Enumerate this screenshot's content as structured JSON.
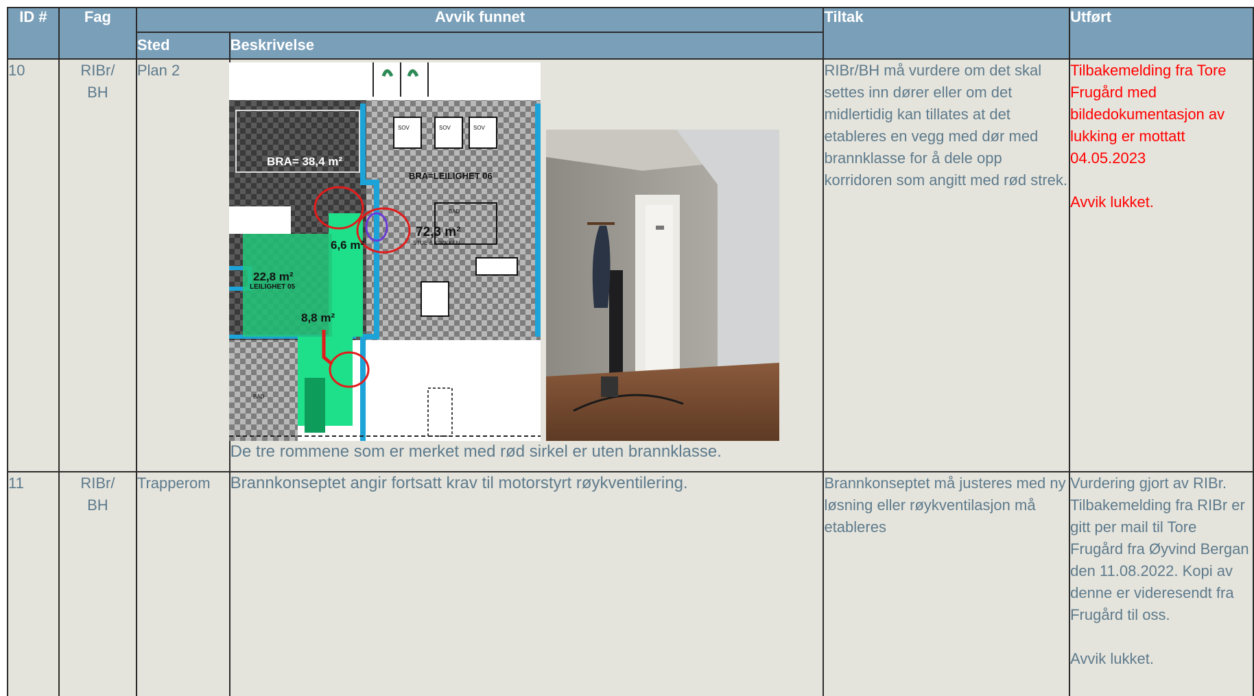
{
  "headers": {
    "id": "ID #",
    "fag": "Fag",
    "avvik_funnet": "Avvik funnet",
    "sted": "Sted",
    "beskrivelse": "Beskrivelse",
    "tiltak": "Tiltak",
    "utfort": "Utført"
  },
  "rows": [
    {
      "id": "10",
      "fag_line1": "RIBr/",
      "fag_line2": "BH",
      "sted": "Plan 2",
      "beskrivelse": "De tre rommene som er merket med rød sirkel er uten brannklasse.",
      "tiltak": "RIBr/BH må vurdere om det skal settes inn dører eller om det midlertidig kan tillates at det etableres en vegg med dør med brannklasse for å dele opp korridoren som angitt med rød strek.",
      "utfort_p1": "Tilbakemelding fra Tore Frugård med bildedokumentasjon av lukking er mottatt 04.05.2023",
      "utfort_p2": "Avvik lukket.",
      "plan_labels": {
        "bra_38": "BRA= 38,4 m²",
        "bra_leil06": "BRA=LEILIGHET 06",
        "area_72": "72,3 m²",
        "stue": "STUE & KJØKKEN",
        "area_66": "6,6 m²",
        "area_228": "22,8 m²",
        "leil05": "LEILIGHET 05",
        "area_88": "8,8 m²",
        "sov": "SOV",
        "bad": "BAD"
      }
    },
    {
      "id": "11",
      "fag_line1": "RIBr/",
      "fag_line2": "BH",
      "sted": "Trapperom",
      "beskrivelse": "Brannkonseptet angir fortsatt krav til motorstyrt røykventilering.",
      "tiltak": "Brannkonseptet må justeres med ny løsning eller røykventilasjon må etableres",
      "utfort_p1": "Vurdering gjort av RIBr. Tilbakemelding fra RIBr er gitt per mail til Tore Frugård fra Øyvind Bergan den 11.08.2022. Kopi av denne er videresendt fra Frugård til oss.",
      "utfort_p2": "Avvik lukket."
    }
  ],
  "colors": {
    "header_bg": "#7a9fb9",
    "cell_bg": "#e5e4dc",
    "text": "#5d7a8c",
    "closed_text": "#ff0000",
    "border": "#2b2b2b"
  }
}
